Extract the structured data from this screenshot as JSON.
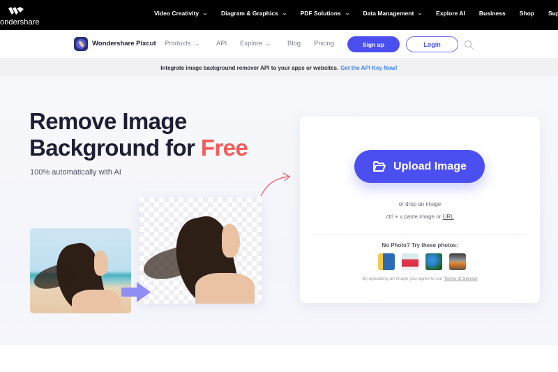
{
  "topbar": {
    "brand": "ondershare",
    "nav": [
      {
        "label": "Video Creativity",
        "has_dropdown": true
      },
      {
        "label": "Diagram & Graphics",
        "has_dropdown": true
      },
      {
        "label": "PDF Solutions",
        "has_dropdown": true
      },
      {
        "label": "Data Management",
        "has_dropdown": true
      },
      {
        "label": "Explore AI",
        "has_dropdown": false
      },
      {
        "label": "Business",
        "has_dropdown": false
      },
      {
        "label": "Shop",
        "has_dropdown": false
      },
      {
        "label": "Supp",
        "has_dropdown": false
      }
    ]
  },
  "product_nav": {
    "brand": "Wondershare Pixcut",
    "links": [
      {
        "label": "Products",
        "has_dropdown": true
      },
      {
        "label": "API",
        "has_dropdown": false
      },
      {
        "label": "Explore",
        "has_dropdown": true
      },
      {
        "label": "Blog",
        "has_dropdown": false
      },
      {
        "label": "Pricing",
        "has_dropdown": false
      }
    ],
    "signup_label": "Sign up",
    "login_label": "Login",
    "search_icon": "search-icon"
  },
  "banner": {
    "text": "Integrate image background remover API to your apps or websites.",
    "link": "Get the API Key Now!"
  },
  "hero": {
    "title_line1": "Remove Image",
    "title_line2_prefix": "Background for ",
    "title_highlight": "Free",
    "subtitle": "100% automatically with AI"
  },
  "upload_card": {
    "upload_label": "Upload Image",
    "upload_icon": "folder-open-icon",
    "drop_text": "or drop an image",
    "paste_text": "ctrl + v paste image or",
    "url_link": "URL",
    "no_photo_text": "No Photo? Try these photos:",
    "sample_photos": [
      "person",
      "drink",
      "parrot",
      "car"
    ],
    "terms_text": "By uploading an image you agree to our",
    "terms_link": "Terms of Service"
  },
  "colors": {
    "accent": "#4b4ff0",
    "highlight": "#f45b5b",
    "link": "#3b82f6",
    "title": "#1d1e33"
  }
}
